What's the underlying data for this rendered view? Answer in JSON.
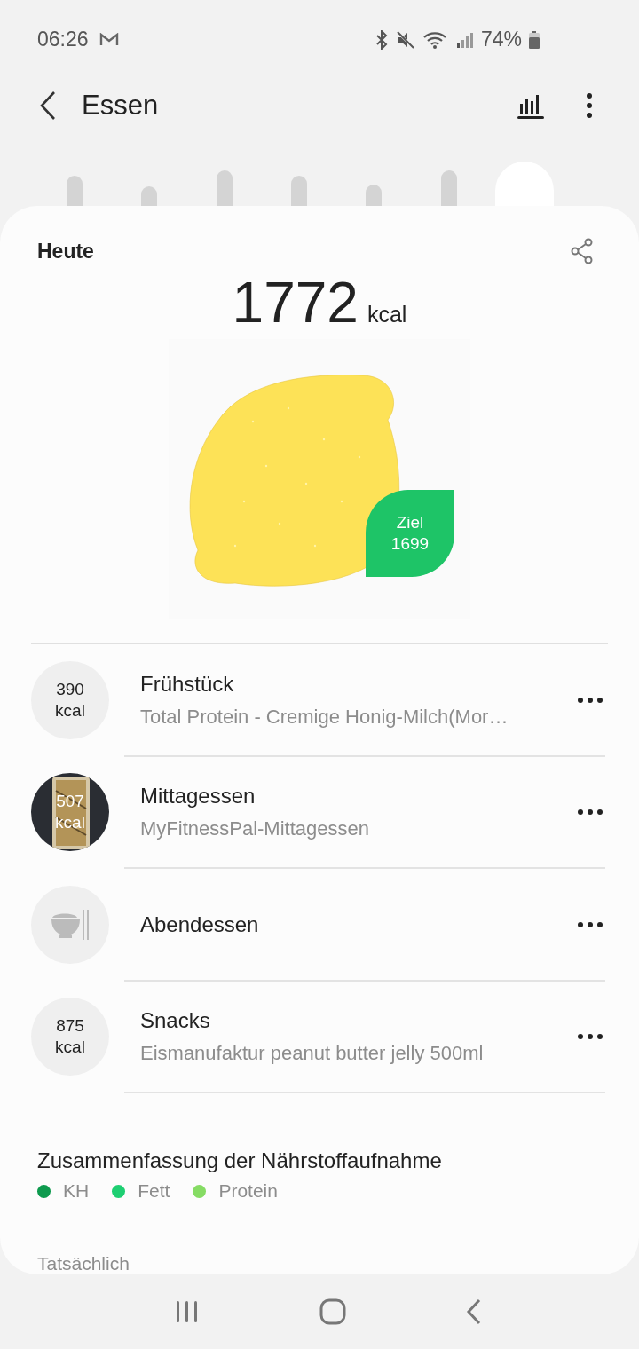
{
  "status_bar": {
    "time": "06:26",
    "battery": "74%"
  },
  "header": {
    "title": "Essen"
  },
  "summary": {
    "period": "Heute",
    "total": "1772",
    "unit": "kcal",
    "goal_label": "Ziel",
    "goal": "1699"
  },
  "meals": [
    {
      "kind": "kcal",
      "value": "390",
      "unit": "kcal",
      "name": "Frühstück",
      "detail": "Total Protein - Cremige Honig-Milch(Mor…"
    },
    {
      "value": "507",
      "unit": "kcal",
      "name": "Mittagessen",
      "detail": "MyFitnessPal-Mittagessen"
    },
    {
      "kind": "empty",
      "name": "Abendessen"
    },
    {
      "kind": "kcal",
      "value": "875",
      "unit": "kcal",
      "name": "Snacks",
      "detail": "Eismanufaktur peanut butter jelly 500ml"
    }
  ],
  "nutrients": {
    "title": "Zusammenfassung der Nährstoffaufnahme",
    "legend": [
      {
        "label": "KH",
        "color": "#0e9a4e"
      },
      {
        "label": "Fett",
        "color": "#1ecf72"
      },
      {
        "label": "Protein",
        "color": "#86dc64"
      }
    ],
    "next_label": "Tatsächlich"
  }
}
